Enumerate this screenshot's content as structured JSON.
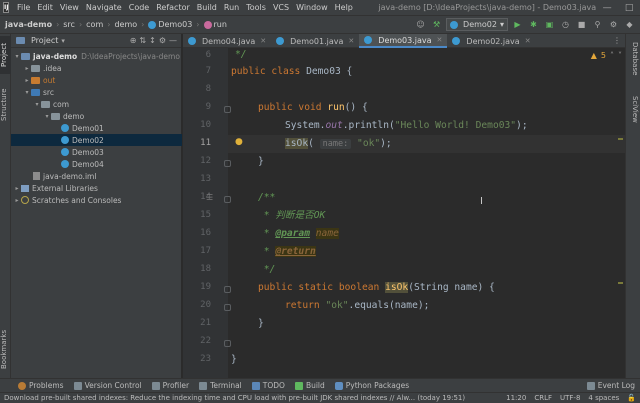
{
  "menu": {
    "logo": "IJ",
    "items": [
      "File",
      "Edit",
      "View",
      "Navigate",
      "Code",
      "Refactor",
      "Build",
      "Run",
      "Tools",
      "VCS",
      "Window",
      "Help"
    ],
    "window_title": "java-demo [D:\\IdeaProjects\\java-demo] - Demo03.java"
  },
  "navbar": {
    "crumbs": [
      "java-demo",
      "src",
      "com",
      "demo",
      "Demo03",
      "run"
    ],
    "run_config": "Demo02"
  },
  "left_stripe": {
    "project": "Project",
    "structure": "Structure",
    "bookmarks": "Bookmarks"
  },
  "project": {
    "title": "Project",
    "tree": [
      {
        "label": "java-demo",
        "extra": "D:\\IdeaProjects\\java-demo"
      },
      {
        "label": ".idea"
      },
      {
        "label": "out"
      },
      {
        "label": "src"
      },
      {
        "label": "com"
      },
      {
        "label": "demo"
      },
      {
        "label": "Demo01"
      },
      {
        "label": "Demo02"
      },
      {
        "label": "Demo03"
      },
      {
        "label": "Demo04"
      },
      {
        "label": "java-demo.iml"
      },
      {
        "label": "External Libraries"
      },
      {
        "label": "Scratches and Consoles"
      }
    ]
  },
  "tabs": [
    "Demo04.java",
    "Demo01.java",
    "Demo03.java",
    "Demo02.java"
  ],
  "editor": {
    "warning_count": "5",
    "line_numbers": [
      "6",
      "7",
      "8",
      "9",
      "10",
      "11",
      "12",
      "13",
      "14",
      "15",
      "16",
      "17",
      "18",
      "19",
      "20",
      "21",
      "22",
      "23"
    ],
    "lines": {
      "l6": "*/",
      "l7_kw": "public class",
      "l7_rest": " Demo03 {",
      "l9_kw": "public void",
      "l9_meth": " run",
      "l9_rest": "() {",
      "l10_a": "System.",
      "l10_out": "out",
      "l10_b": ".println(",
      "l10_str": "\"Hello World! Demo03\"",
      "l10_c": ");",
      "l11_call": "isOk",
      "l11_a": "(",
      "l11_hint": "name:",
      "l11_str": "\"ok\"",
      "l11_b": ");",
      "l12": "}",
      "l14": "/**",
      "l15": " * 判断是否OK",
      "l16_star": " * ",
      "l16_tag": "@param",
      "l16_val": "name",
      "l17_star": " * ",
      "l17_tag": "@return",
      "l18": " */",
      "l19_kw": "public static boolean",
      "l19_meth": "isOk",
      "l19_rest": "(String name) {",
      "l20_kw": "return",
      "l20_str": "\"ok\"",
      "l20_rest": ".equals(name);",
      "l21": "}",
      "l23": "}"
    }
  },
  "right_stripe": {
    "database": "Database",
    "sciview": "SciView"
  },
  "tool_windows": [
    "Problems",
    "Version Control",
    "Profiler",
    "Terminal",
    "TODO",
    "Build",
    "Python Packages"
  ],
  "event_log": "Event Log",
  "status": {
    "message": "Download pre-built shared indexes: Reduce the indexing time and CPU load with pre-built JDK shared indexes // Alw... (today 19:51)",
    "position": "11:20",
    "line_sep": "CRLF",
    "encoding": "UTF-8",
    "indent": "4 spaces"
  }
}
